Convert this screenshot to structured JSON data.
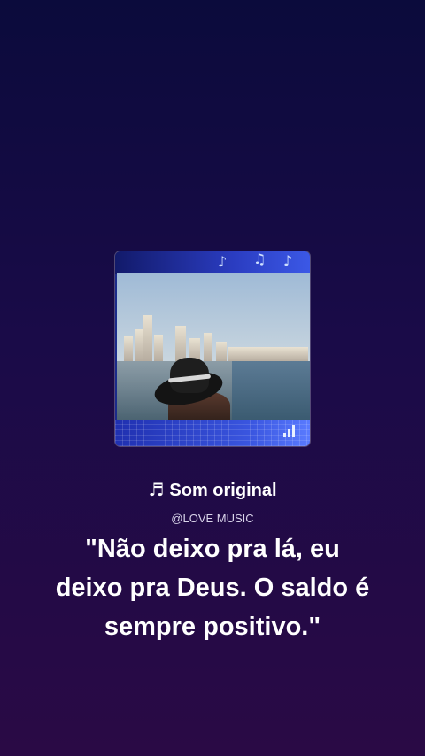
{
  "sound": {
    "icon": "music-note-icon",
    "icon_glyph": "♬",
    "title": "Som original",
    "author": "@LOVE MUSIC"
  },
  "quote": {
    "text": "\"Não deixo pra lá, eu deixo pra Deus. O saldo é sempre positivo.\""
  },
  "cover": {
    "decorations": [
      "music-notes-icon",
      "signal-bars-icon"
    ],
    "note_glyphs": [
      "♪",
      "♫",
      "♪"
    ]
  },
  "colors": {
    "background_top": "#0b0b3c",
    "background_bottom": "#2a0a45",
    "cover_accent": "#3b58e6",
    "text": "#ffffff"
  }
}
